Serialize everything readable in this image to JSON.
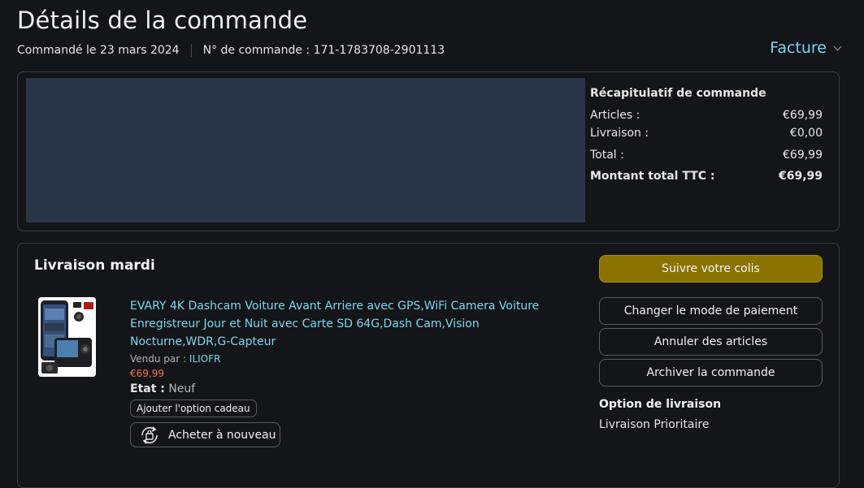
{
  "page": {
    "title": "Détails de la commande",
    "ordered_on": "Commandé le 23 mars 2024",
    "order_number": "N° de commande : 171-1783708-2901113",
    "invoice_label": "Facture"
  },
  "summary": {
    "heading": "Récapitulatif de commande",
    "rows": [
      {
        "label": "Articles :",
        "value": "€69,99"
      },
      {
        "label": "Livraison :",
        "value": "€0,00"
      },
      {
        "label": "Total :",
        "value": "€69,99"
      },
      {
        "label": "Montant total TTC :",
        "value": "€69,99"
      }
    ]
  },
  "delivery": {
    "title": "Livraison mardi",
    "product": {
      "title": "EVARY 4K Dashcam Voiture Avant Arriere avec GPS,WiFi Camera Voiture Enregistreur Jour et Nuit avec Carte SD 64G,Dash Cam,Vision Nocturne,WDR,G-Capteur",
      "sold_by_label": "Vendu par :",
      "seller": "ILIOFR",
      "price": "€69,99",
      "state_label": "Etat :",
      "state_value": "Neuf",
      "gift_label": "Ajouter l'option cadeau",
      "rebuy_label": "Acheter à nouveau"
    },
    "actions": {
      "track": "Suivre votre colis",
      "change_payment": "Changer le mode de paiement",
      "cancel_items": "Annuler des articles",
      "archive": "Archiver la commande"
    },
    "shipping_option": {
      "heading": "Option de livraison",
      "value": "Livraison Prioritaire"
    }
  },
  "colors": {
    "background": "#141518",
    "link": "#7ad7f0",
    "price": "#f2705a",
    "primary_button": "#8a7300",
    "placeholder_panel": "#2a3547"
  }
}
